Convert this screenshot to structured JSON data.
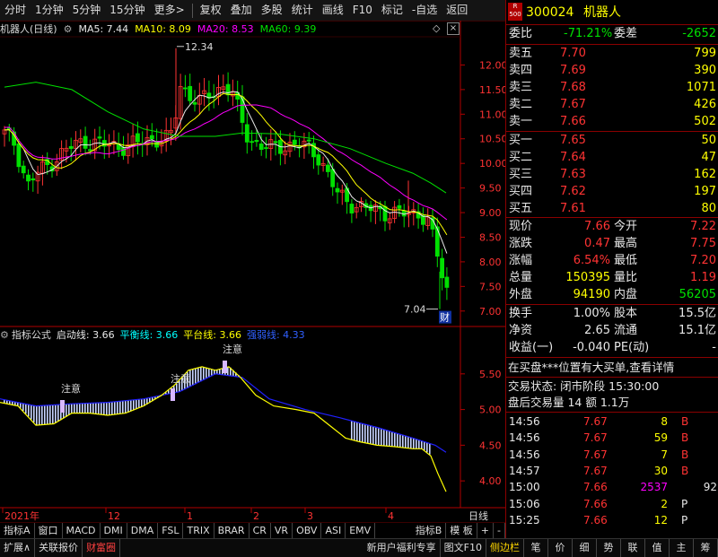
{
  "colors": {
    "up": "#ff3333",
    "down": "#00e000",
    "ma5": "#e8e8e8",
    "ma10": "#ffff00",
    "ma20": "#ff00ff",
    "ma60": "#00e000",
    "axis": "#b00000",
    "yellow": "#ffff00",
    "blue": "#2020ff"
  },
  "toolbar": {
    "items": [
      "分时",
      "1分钟",
      "5分钟",
      "15分钟",
      "更多>",
      "复权",
      "叠加",
      "多股",
      "统计",
      "画线",
      "F10",
      "标记",
      "-自选",
      "返回"
    ]
  },
  "chart": {
    "title": "机器人(日线)",
    "ma5_label": "MA5: 7.44",
    "ma10_label": "MA10: 8.09",
    "ma20_label": "MA20: 8.53",
    "ma60_label": "MA60: 9.39",
    "high_label": "12.34",
    "low_label": "7.04",
    "fin_badge": "财",
    "yticks": [
      "12.00",
      "11.50",
      "11.00",
      "10.50",
      "10.00",
      "9.50",
      "9.00",
      "8.50",
      "8.00",
      "7.50",
      "7.00"
    ],
    "ymin": 6.85,
    "ymax": 12.5
  },
  "indicator": {
    "name": "指标公式",
    "line1": "启动线: 3.66",
    "line2": "平衡线: 3.66",
    "line3": "平台线: 3.66",
    "line4": "强弱线: 4.33",
    "notes": [
      "注意",
      "注意",
      "注意"
    ],
    "yticks": [
      "5.50",
      "5.00",
      "4.50",
      "4.00"
    ]
  },
  "xaxis": {
    "labels": [
      "2021年",
      "12",
      "1",
      "2",
      "3",
      "4"
    ],
    "period": "日线"
  },
  "bottom_tabs": [
    "指标A",
    "窗口",
    "MACD",
    "DMI",
    "DMA",
    "FSL",
    "TRIX",
    "BRAR",
    "CR",
    "VR",
    "OBV",
    "ASI",
    "EMV",
    "指标B",
    "模 板",
    "+",
    "-"
  ],
  "status_tabs_left": [
    "扩展∧",
    "关联报价",
    "财富圈"
  ],
  "status_tabs_mid": [
    "新用户福利专享",
    "图文F10",
    "侧边栏"
  ],
  "status_tabs_right": [
    "笔",
    "价",
    "细",
    "势",
    "联",
    "值",
    "主",
    "筹"
  ],
  "quote": {
    "badge_top": "R",
    "badge_bottom": "500",
    "code": "300024",
    "name": "机器人",
    "weibi_label": "委比",
    "weibi": "-71.21%",
    "weicha_label": "委差",
    "weicha": "-2652",
    "asks": [
      {
        "label": "卖五",
        "price": "7.70",
        "vol": "799"
      },
      {
        "label": "卖四",
        "price": "7.69",
        "vol": "390"
      },
      {
        "label": "卖三",
        "price": "7.68",
        "vol": "1071"
      },
      {
        "label": "卖二",
        "price": "7.67",
        "vol": "426"
      },
      {
        "label": "卖一",
        "price": "7.66",
        "vol": "502"
      }
    ],
    "bids": [
      {
        "label": "买一",
        "price": "7.65",
        "vol": "50"
      },
      {
        "label": "买二",
        "price": "7.64",
        "vol": "47"
      },
      {
        "label": "买三",
        "price": "7.63",
        "vol": "162"
      },
      {
        "label": "买四",
        "price": "7.62",
        "vol": "197"
      },
      {
        "label": "买五",
        "price": "7.61",
        "vol": "80"
      }
    ],
    "stats": [
      {
        "l1": "现价",
        "v1": "7.66",
        "l2": "今开",
        "v2": "7.22"
      },
      {
        "l1": "涨跌",
        "v1": "0.47",
        "l2": "最高",
        "v2": "7.75"
      },
      {
        "l1": "涨幅",
        "v1": "6.54%",
        "l2": "最低",
        "v2": "7.20"
      },
      {
        "l1": "总量",
        "v1": "150395",
        "l2": "量比",
        "v2": "1.19"
      },
      {
        "l1": "外盘",
        "v1": "94190",
        "l2": "内盘",
        "v2": "56205"
      }
    ],
    "stats2": [
      {
        "l1": "换手",
        "v1": "1.00%",
        "l2": "股本",
        "v2": "15.5亿"
      },
      {
        "l1": "净资",
        "v1": "2.65",
        "l2": "流通",
        "v2": "15.1亿"
      },
      {
        "l1": "收益(一)",
        "v1": "-0.040",
        "l2": "PE(动)",
        "v2": "-"
      }
    ],
    "news": "在买盘***位置有大买单,查看详情",
    "trade_status": "交易状态: 闭市阶段 15:30:00",
    "after_hours": "盘后交易量 14 额 1.1万",
    "ticks": [
      {
        "t": "14:56",
        "p": "7.67",
        "v": "8",
        "f": "B"
      },
      {
        "t": "14:56",
        "p": "7.67",
        "v": "59",
        "f": "B"
      },
      {
        "t": "14:56",
        "p": "7.67",
        "v": "7",
        "f": "B"
      },
      {
        "t": "14:57",
        "p": "7.67",
        "v": "30",
        "f": "B"
      },
      {
        "t": "15:00",
        "p": "7.66",
        "v": "2537",
        "f": "",
        "x": "92"
      },
      {
        "t": "15:06",
        "p": "7.66",
        "v": "2",
        "f": "P"
      },
      {
        "t": "15:25",
        "p": "7.66",
        "v": "12",
        "f": "P"
      }
    ]
  }
}
